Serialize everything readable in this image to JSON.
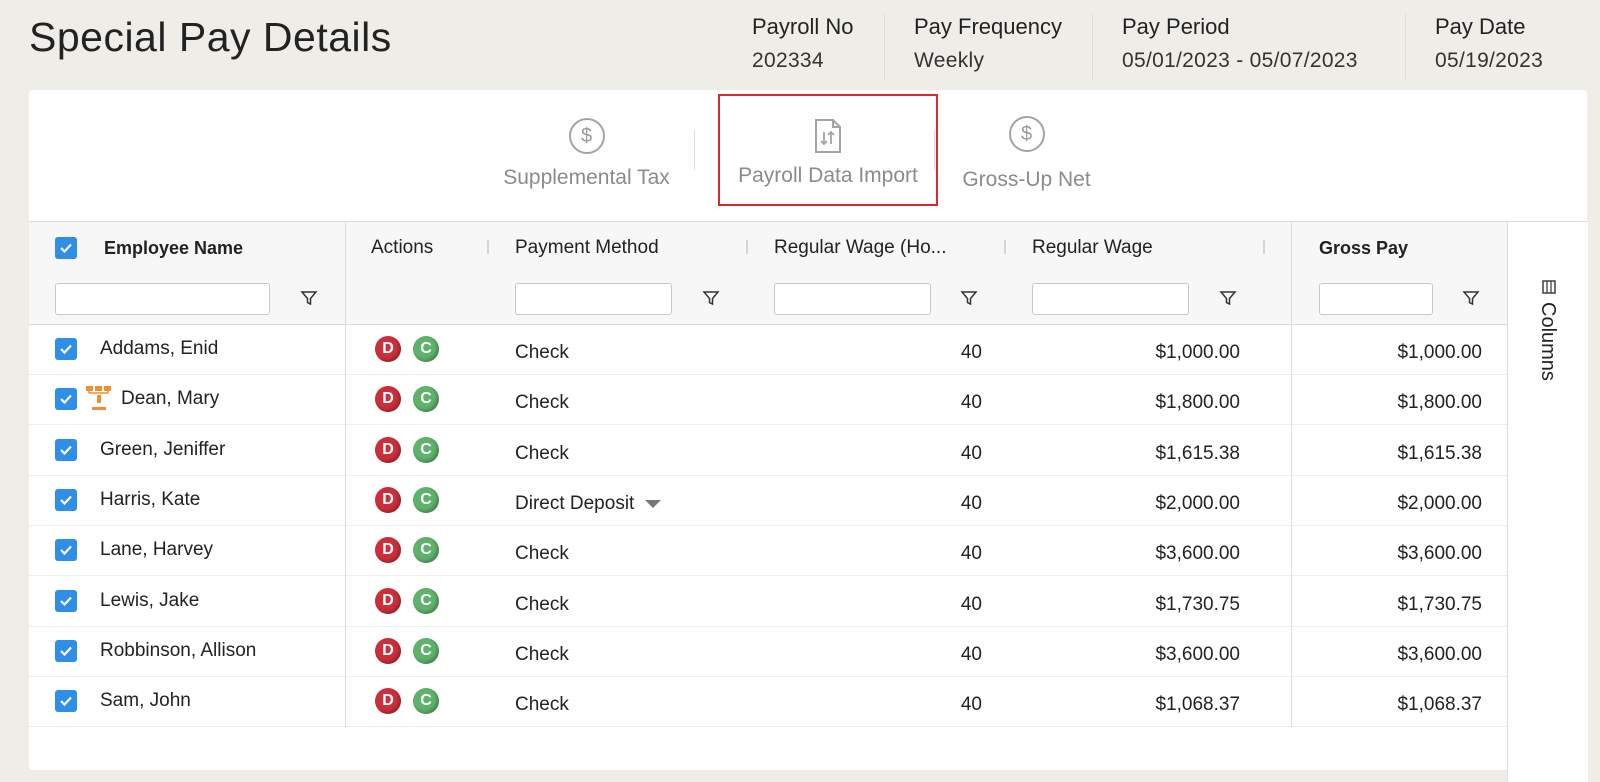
{
  "page": {
    "title": "Special Pay Details"
  },
  "meta": {
    "payroll_no": {
      "label": "Payroll No",
      "value": "202334"
    },
    "pay_frequency": {
      "label": "Pay Frequency",
      "value": "Weekly"
    },
    "pay_period": {
      "label": "Pay Period",
      "value": "05/01/2023 - 05/07/2023"
    },
    "pay_date": {
      "label": "Pay Date",
      "value": "05/19/2023"
    }
  },
  "toolbar": {
    "supplemental_tax": {
      "label": "Supplemental Tax",
      "icon": "dollar-circle-icon"
    },
    "payroll_data_import": {
      "label": "Payroll Data Import",
      "icon": "file-transfer-icon",
      "highlighted": true
    },
    "gross_up_net": {
      "label": "Gross-Up Net",
      "icon": "dollar-circle-icon"
    }
  },
  "grid": {
    "columns": {
      "employee_name": "Employee Name",
      "actions": "Actions",
      "payment_method": "Payment Method",
      "regular_wage_hours": "Regular Wage (Ho...",
      "regular_wage": "Regular Wage",
      "gross_pay": "Gross Pay"
    },
    "side_tab": "Columns",
    "action_labels": {
      "d": "D",
      "c": "C"
    },
    "rows": [
      {
        "name": "Addams, Enid",
        "payment_method": "Check",
        "hours": "40",
        "regular_wage": "$1,000.00",
        "gross_pay": "$1,000.00"
      },
      {
        "name": "Dean, Mary",
        "payment_method": "Check",
        "hours": "40",
        "regular_wage": "$1,800.00",
        "gross_pay": "$1,800.00",
        "has_org_icon": true
      },
      {
        "name": "Green, Jeniffer",
        "payment_method": "Check",
        "hours": "40",
        "regular_wage": "$1,615.38",
        "gross_pay": "$1,615.38"
      },
      {
        "name": "Harris, Kate",
        "payment_method": "Direct Deposit",
        "hours": "40",
        "regular_wage": "$2,000.00",
        "gross_pay": "$2,000.00",
        "dropdown": true
      },
      {
        "name": "Lane, Harvey",
        "payment_method": "Check",
        "hours": "40",
        "regular_wage": "$3,600.00",
        "gross_pay": "$3,600.00"
      },
      {
        "name": "Lewis, Jake",
        "payment_method": "Check",
        "hours": "40",
        "regular_wage": "$1,730.75",
        "gross_pay": "$1,730.75"
      },
      {
        "name": "Robbinson, Allison",
        "payment_method": "Check",
        "hours": "40",
        "regular_wage": "$3,600.00",
        "gross_pay": "$3,600.00"
      },
      {
        "name": "Sam, John",
        "payment_method": "Check",
        "hours": "40",
        "regular_wage": "$1,068.37",
        "gross_pay": "$1,068.37"
      }
    ]
  }
}
